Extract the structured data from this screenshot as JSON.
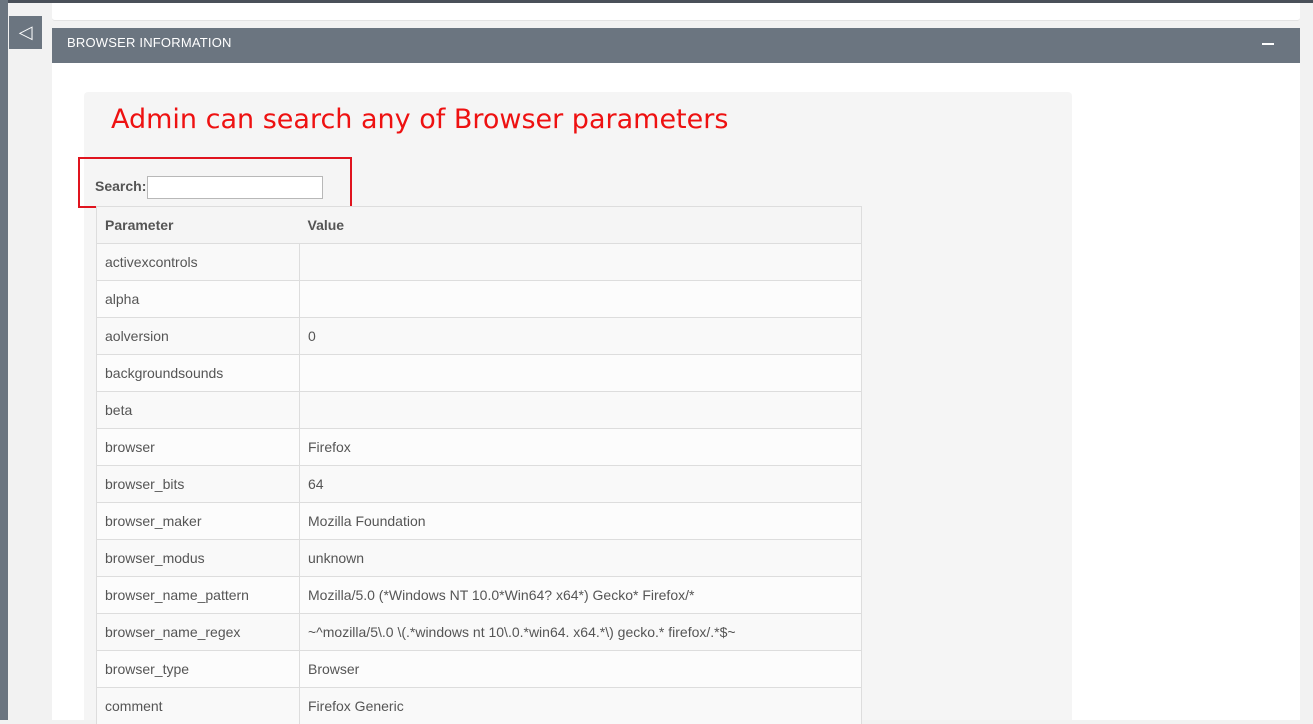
{
  "sidebar": {
    "collapse_icon": "◁"
  },
  "panel": {
    "title": "BROWSER INFORMATION",
    "toggle_icon": "minus-icon"
  },
  "annotation": {
    "text": "Admin can search any of Browser parameters",
    "color": "#ee1111"
  },
  "search": {
    "label": "Search:",
    "value": "",
    "placeholder": ""
  },
  "table": {
    "headers": [
      "Parameter",
      "Value"
    ],
    "rows": [
      [
        "activexcontrols",
        ""
      ],
      [
        "alpha",
        ""
      ],
      [
        "aolversion",
        "0"
      ],
      [
        "backgroundsounds",
        ""
      ],
      [
        "beta",
        ""
      ],
      [
        "browser",
        "Firefox"
      ],
      [
        "browser_bits",
        "64"
      ],
      [
        "browser_maker",
        "Mozilla Foundation"
      ],
      [
        "browser_modus",
        "unknown"
      ],
      [
        "browser_name_pattern",
        "Mozilla/5.0 (*Windows NT 10.0*Win64? x64*) Gecko* Firefox/*"
      ],
      [
        "browser_name_regex",
        "~^mozilla/5\\.0 \\(.*windows nt 10\\.0.*win64. x64.*\\) gecko.* firefox/.*$~"
      ],
      [
        "browser_type",
        "Browser"
      ],
      [
        "comment",
        "Firefox Generic"
      ]
    ]
  },
  "colors": {
    "header_bg": "#6b7580",
    "highlight_border": "#e0141e"
  }
}
